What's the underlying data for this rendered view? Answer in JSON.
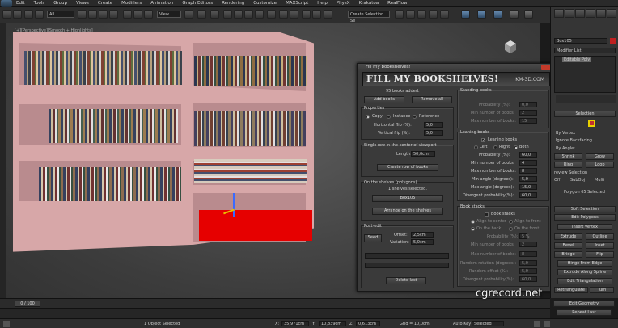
{
  "menu": [
    "Edit",
    "Tools",
    "Group",
    "Views",
    "Create",
    "Modifiers",
    "Animation",
    "Graph Editors",
    "Rendering",
    "Customize",
    "MAXScript",
    "Help",
    "PhysX",
    "Krakatoa",
    "RealFlow"
  ],
  "toolbar": {
    "selection_filter": "All",
    "ref_coord": "View",
    "named_selection": "Create Selection Se"
  },
  "viewport": {
    "label": "[+][Perspective][Smooth + Highlights]"
  },
  "dialog": {
    "title": "Fill my bookshelves!",
    "banner_title": "FILL MY BOOKSHELVES!",
    "banner_site": "KM-3D.COM",
    "status": "95 books added.",
    "add_books": "Add books",
    "remove_all": "Remove all",
    "properties": {
      "title": "Properties",
      "copy": "Copy",
      "instance": "Instance",
      "reference": "Reference",
      "hflip_label": "Horizontal flip (%):",
      "hflip_value": "5,0",
      "vflip_label": "Vertical flip (%):",
      "vflip_value": "5,0"
    },
    "single_row": {
      "title": "Single row in the center of viewport",
      "length_label": "Length:",
      "length_value": "50,0cm",
      "create": "Create row of books"
    },
    "on_shelves": {
      "title": "On the shelves (polygons)",
      "selected": "1 shelves selected.",
      "box": "Box105",
      "arrange": "Arrange on the shelves"
    },
    "post_edit": {
      "title": "Post-edit",
      "seed": "Seed",
      "offset_label": "Offset:",
      "offset_value": "2,5cm",
      "variation_label": "Variation:",
      "variation_value": "5,0cm",
      "delete_last": "Delete last"
    },
    "standing": {
      "title": "Standing books",
      "prob_label": "Probability (%):",
      "prob_value": "0,0",
      "min_label": "Min number of books:",
      "min_value": "2",
      "max_label": "Max number of books:",
      "max_value": "15"
    },
    "leaning": {
      "title": "Leaning books",
      "chk_label": "Leaning books",
      "left": "Left",
      "right": "Right",
      "both": "Both",
      "prob_label": "Probability (%):",
      "prob_value": "60,0",
      "min_label": "Min number of books:",
      "min_value": "4",
      "max_label": "Max number of books:",
      "max_value": "8",
      "minang_label": "Min angle (degrees):",
      "minang_value": "5,0",
      "maxang_label": "Max angle (degrees):",
      "maxang_value": "15,0",
      "div_label": "Divergent probability(%):",
      "div_value": "60,0"
    },
    "stacks": {
      "title": "Book stacks",
      "chk_label": "Book stacks",
      "align_center": "Align to center",
      "align_front": "Align to front",
      "on_back": "On the back",
      "on_front": "On the front",
      "prob_label": "Probability (%):",
      "prob_value": "5 %",
      "min_label": "Min number of books:",
      "min_value": "2",
      "max_label": "Max number of books:",
      "max_value": "8",
      "rot_label": "Random rotation (degrees):",
      "rot_value": "5,0",
      "off_label": "Random offset (%):",
      "off_value": "5,0",
      "div_label": "Divergent probability(%):",
      "div_value": "60,0"
    }
  },
  "command_panel": {
    "object_name": "Box105",
    "modifier_list": "Modifier List",
    "stack_item": "Editable Poly",
    "selection_title": "Selection",
    "by_vertex": "By Vertex",
    "ignore_backfacing": "Ignore Backfacing",
    "by_angle": "By Angle:",
    "shrink": "Shrink",
    "grow": "Grow",
    "ring": "Ring",
    "loop": "Loop",
    "preview": "review Selection",
    "off": "Off",
    "subobj": "SubObj",
    "multi": "Multi",
    "selected": "Polygon 65 Selected",
    "soft": "Soft Selection",
    "edit_polygons": "Edit Polygons",
    "insert_vertex": "Insert Vertex",
    "extrude": "Extrude",
    "outline": "Outline",
    "bevel": "Bevel",
    "inset": "Inset",
    "bridge": "Bridge",
    "flip": "Flip",
    "hinge": "Hinge From Edge",
    "spline": "Extrude Along Spline",
    "edit_tri": "Edit Triangulation",
    "retri": "Retriangulate",
    "turn": "Turn",
    "edit_geom": "Edit Geometry",
    "repeat": "Repeat Last"
  },
  "timeslider": {
    "label": "0 / 100"
  },
  "status": {
    "objects": "1 Object Selected",
    "x": "35,971cm",
    "y": "10,839cm",
    "z": "0,613cm",
    "grid": "Grid = 10,0cm",
    "autokey": "Auto Key",
    "selected": "Selected"
  },
  "watermark": "cgrecord.net",
  "colors": {
    "shelf": "#d7a7a8",
    "selection_red": "#e60000",
    "bg": "#1b1b1b"
  }
}
